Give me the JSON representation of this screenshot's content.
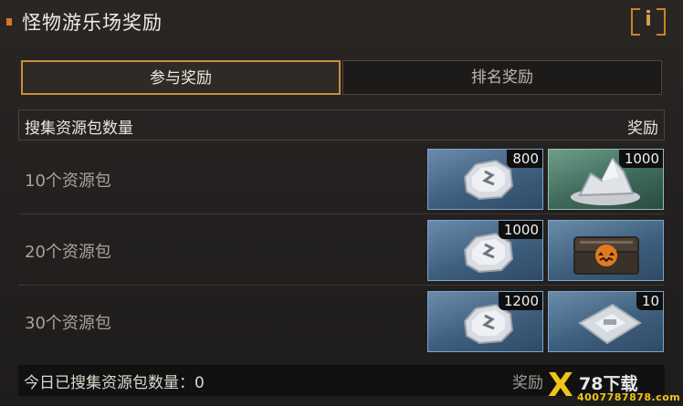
{
  "header": {
    "title": "怪物游乐场奖励",
    "info_label": "i"
  },
  "tabs": [
    {
      "label": "参与奖励",
      "active": true
    },
    {
      "label": "排名奖励",
      "active": false
    }
  ],
  "table": {
    "col_left": "搜集资源包数量",
    "col_right": "奖励",
    "rows": [
      {
        "label": "10个资源包",
        "rewards": [
          {
            "icon": "ore-stone-icon",
            "qty": "800",
            "rarity": "blue"
          },
          {
            "icon": "silver-ore-pile-icon",
            "qty": "1000",
            "rarity": "green"
          }
        ]
      },
      {
        "label": "20个资源包",
        "rewards": [
          {
            "icon": "ore-stone-icon",
            "qty": "1000",
            "rarity": "blue"
          },
          {
            "icon": "pumpkin-chest-icon",
            "qty": "",
            "rarity": "blue"
          }
        ]
      },
      {
        "label": "30个资源包",
        "rewards": [
          {
            "icon": "ore-stone-icon",
            "qty": "1200",
            "rarity": "blue"
          },
          {
            "icon": "supply-pack-icon",
            "qty": "10",
            "rarity": "blue"
          }
        ]
      }
    ]
  },
  "footer": {
    "collected_text": "今日已搜集资源包数量：0",
    "right_text": "奖励"
  },
  "watermark": {
    "brand": "78下载",
    "phone": "4007787878.com"
  },
  "colors": {
    "accent": "#c98d3a",
    "rarity_blue": "#3f5f7e",
    "rarity_green": "#3f6a5b"
  }
}
